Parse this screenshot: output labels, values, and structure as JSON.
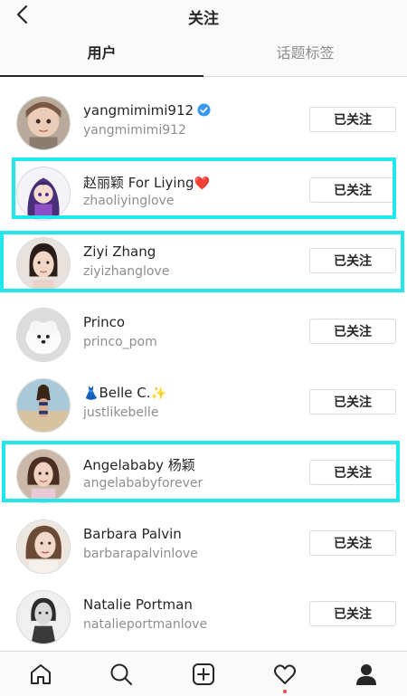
{
  "header": {
    "title": "关注"
  },
  "tabs": [
    {
      "label": "用户",
      "active": true
    },
    {
      "label": "话题标签",
      "active": false
    }
  ],
  "users": [
    {
      "name": "yangmimimi912",
      "handle": "yangmimimi912",
      "verified": true,
      "suffix": "",
      "prefix": "",
      "button": "已关注",
      "highlighted": false,
      "avatar": "child-photo"
    },
    {
      "name": "赵丽颖 For Liying",
      "handle": "zhaoliyinglove",
      "verified": false,
      "suffix": "❤️",
      "prefix": "",
      "button": "已关注",
      "highlighted": true,
      "avatar": "cartoon-girl"
    },
    {
      "name": "Ziyi Zhang",
      "handle": "ziyizhanglove",
      "verified": false,
      "suffix": "",
      "prefix": "",
      "button": "已关注",
      "highlighted": true,
      "avatar": "portrait-photo"
    },
    {
      "name": "Princo",
      "handle": "princo_pom",
      "verified": false,
      "suffix": "",
      "prefix": "",
      "button": "已关注",
      "highlighted": false,
      "avatar": "white-dog-photo"
    },
    {
      "name": "Belle C.",
      "handle": "justlikebelle",
      "verified": false,
      "suffix": "✨",
      "prefix": "👗",
      "button": "已关注",
      "highlighted": false,
      "avatar": "beach-photo"
    },
    {
      "name": "Angelababy 杨颖",
      "handle": "angelababyforever",
      "verified": false,
      "suffix": "",
      "prefix": "",
      "button": "已关注",
      "highlighted": true,
      "avatar": "portrait-photo"
    },
    {
      "name": "Barbara Palvin",
      "handle": "barbarapalvinlove",
      "verified": false,
      "suffix": "",
      "prefix": "",
      "button": "已关注",
      "highlighted": false,
      "avatar": "portrait-photo"
    },
    {
      "name": "Natalie Portman",
      "handle": "natalieportmanlove",
      "verified": false,
      "suffix": "",
      "prefix": "",
      "button": "已关注",
      "highlighted": false,
      "avatar": "bw-portrait-photo"
    }
  ],
  "bottom_nav": [
    "home-icon",
    "search-icon",
    "add-post-icon",
    "activity-heart-icon",
    "profile-icon"
  ],
  "colors": {
    "highlight": "#21e6ec",
    "verified_badge": "#3897f0",
    "secondary_text": "#8e8e8e",
    "notification_dot": "#ed4956"
  }
}
